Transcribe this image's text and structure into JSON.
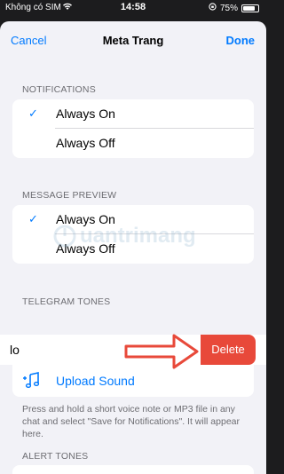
{
  "status": {
    "carrier": "Không có SIM",
    "time": "14:58",
    "battery": "75%"
  },
  "nav": {
    "cancel": "Cancel",
    "title": "Meta Trang",
    "done": "Done"
  },
  "notifications": {
    "header": "NOTIFICATIONS",
    "options": [
      {
        "label": "Always On",
        "selected": true
      },
      {
        "label": "Always Off",
        "selected": false
      }
    ]
  },
  "message_preview": {
    "header": "MESSAGE PREVIEW",
    "options": [
      {
        "label": "Always On",
        "selected": true
      },
      {
        "label": "Always Off",
        "selected": false
      }
    ]
  },
  "telegram_tones": {
    "header": "TELEGRAM TONES",
    "tone_label": "lo",
    "delete_label": "Delete",
    "upload_label": "Upload Sound",
    "footer": "Press and hold a short voice note or MP3 file in any chat and select \"Save for Notifications\". It will appear here."
  },
  "alert_tones": {
    "header": "ALERT TONES"
  },
  "watermark": "uantrimang",
  "colors": {
    "accent": "#007aff",
    "delete": "#e8493a",
    "arrow": "#e8493a"
  }
}
